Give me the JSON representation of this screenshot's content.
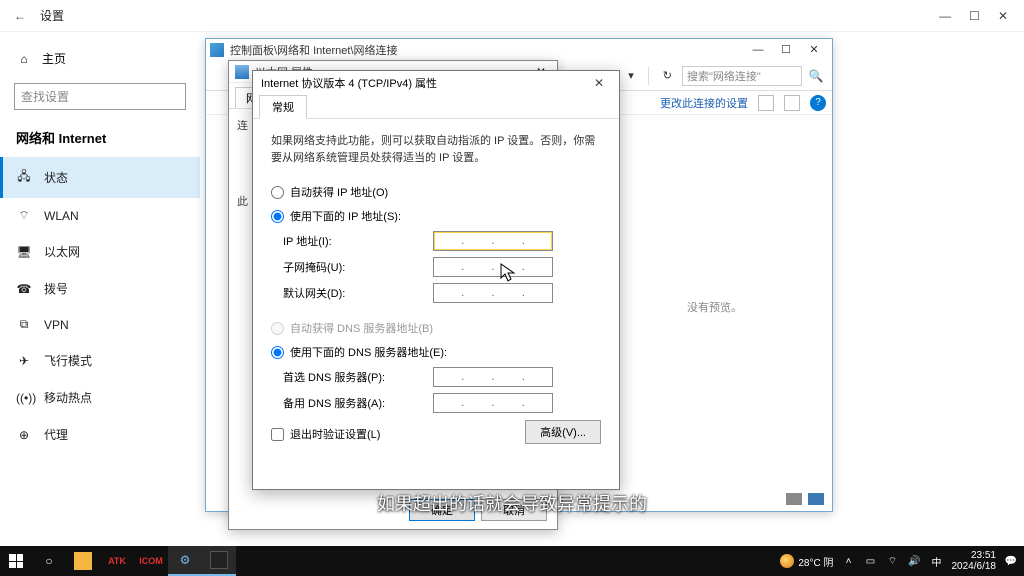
{
  "settings": {
    "title": "设置",
    "search_placeholder": "查找设置",
    "home": "主页",
    "section": "网络和 Internet",
    "items": [
      {
        "icon": "🖧",
        "label": "状态",
        "active": true
      },
      {
        "icon": "⌔",
        "label": "WLAN"
      },
      {
        "icon": "🖥",
        "label": "以太网"
      },
      {
        "icon": "☎",
        "label": "拨号"
      },
      {
        "icon": "⧉",
        "label": "VPN"
      },
      {
        "icon": "✈",
        "label": "飞行模式"
      },
      {
        "icon": "((•))",
        "label": "移动热点"
      },
      {
        "icon": "⊕",
        "label": "代理"
      }
    ]
  },
  "controlpanel": {
    "title": "控制面板\\网络和 Internet\\网络连接",
    "search_placeholder": "搜索\"网络连接\"",
    "change_settings": "更改此连接的设置",
    "no_preview": "没有预览。",
    "refresh_icon": "↻",
    "dropdown_icon": "▾"
  },
  "ethprops": {
    "title": "以太网 属性",
    "tab_network": "网络",
    "label_connect": "连",
    "label_items": "此",
    "ok": "确定",
    "cancel": "取消"
  },
  "ipv4": {
    "title": "Internet 协议版本 4 (TCP/IPv4) 属性",
    "tab_general": "常规",
    "description": "如果网络支持此功能，则可以获取自动指派的 IP 设置。否则，你需要从网络系统管理员处获得适当的 IP 设置。",
    "auto_ip": "自动获得 IP 地址(O)",
    "manual_ip": "使用下面的 IP 地址(S):",
    "ip_label": "IP 地址(I):",
    "mask_label": "子网掩码(U):",
    "gateway_label": "默认网关(D):",
    "auto_dns": "自动获得 DNS 服务器地址(B)",
    "manual_dns": "使用下面的 DNS 服务器地址(E):",
    "dns1_label": "首选 DNS 服务器(P):",
    "dns2_label": "备用 DNS 服务器(A):",
    "validate": "退出时验证设置(L)",
    "advanced": "高级(V)...",
    "ip_selected": "manual",
    "dns_selected": "manual"
  },
  "subtitle": "如果超出的话就会导致异常提示的",
  "taskbar": {
    "weather": "28°C 阴",
    "time": "23:51",
    "date": "2024/6/18",
    "ime": "中"
  }
}
